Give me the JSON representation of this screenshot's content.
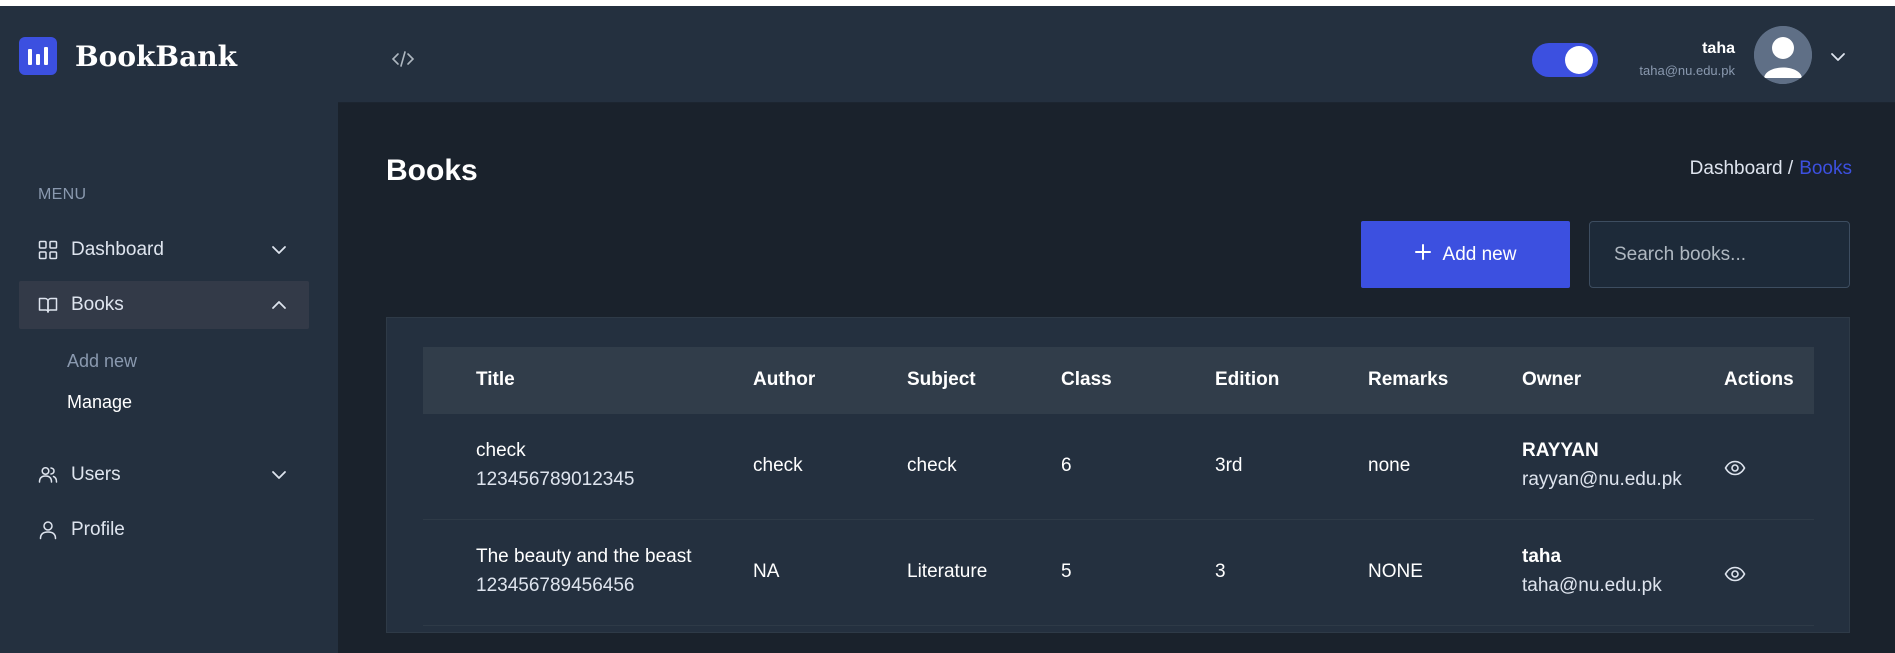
{
  "app": {
    "brand": "BookBank",
    "theme_toggle_on": true
  },
  "user": {
    "name": "taha",
    "email": "taha@nu.edu.pk"
  },
  "sidebar": {
    "menu_label": "MENU",
    "items": [
      {
        "label": "Dashboard",
        "icon": "grid-icon",
        "expanded": false
      },
      {
        "label": "Books",
        "icon": "book-icon",
        "expanded": true
      },
      {
        "label": "Users",
        "icon": "users-icon",
        "expanded": false
      },
      {
        "label": "Profile",
        "icon": "user-icon"
      }
    ],
    "books_subitems": [
      {
        "label": "Add new",
        "active": false
      },
      {
        "label": "Manage",
        "active": true
      }
    ]
  },
  "main": {
    "title": "Books",
    "breadcrumb": {
      "home": "Dashboard /",
      "current": "Books"
    },
    "add_button": "Add new",
    "search_placeholder": "Search books..."
  },
  "table": {
    "columns": [
      "Title",
      "Author",
      "Subject",
      "Class",
      "Edition",
      "Remarks",
      "Owner",
      "Actions"
    ],
    "rows": [
      {
        "title": "check",
        "isbn": "123456789012345",
        "author": "check",
        "subject": "check",
        "class": "6",
        "edition": "3rd",
        "remarks": "none",
        "owner_name": "RAYYAN",
        "owner_email": "rayyan@nu.edu.pk",
        "action_icon": "eye-icon"
      },
      {
        "title": "The beauty and the beast",
        "isbn": "123456789456456",
        "author": "NA",
        "subject": "Literature",
        "class": "5",
        "edition": "3",
        "remarks": "NONE",
        "owner_name": "taha",
        "owner_email": "taha@nu.edu.pk",
        "action_icon": "eye-icon"
      }
    ]
  },
  "colors": {
    "accent": "#3c50e0",
    "sidebar_bg": "#24303f",
    "main_bg": "#1a222c"
  }
}
